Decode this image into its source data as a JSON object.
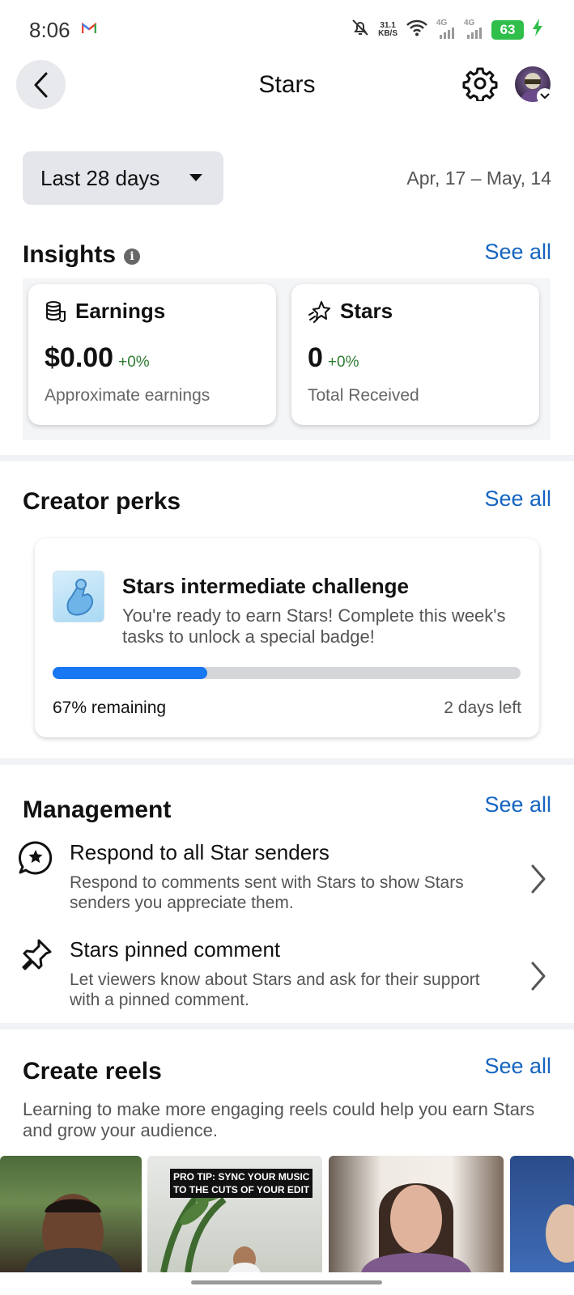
{
  "status_bar": {
    "time": "8:06",
    "net_speed_value": "31.1",
    "net_speed_unit": "KB/S",
    "signal_1": "4G",
    "signal_2": "4G",
    "battery": "63"
  },
  "header": {
    "title": "Stars"
  },
  "date_range": {
    "selected": "Last 28 days",
    "dates": "Apr, 17 – May, 14"
  },
  "insights": {
    "title": "Insights",
    "info_glyph": "i",
    "see_all": "See all",
    "cards": [
      {
        "label": "Earnings",
        "value": "$0.00",
        "change": "+0%",
        "sub": "Approximate earnings",
        "icon": "coins-icon"
      },
      {
        "label": "Stars",
        "value": "0",
        "change": "+0%",
        "sub": "Total Received",
        "icon": "star-burst-icon"
      }
    ]
  },
  "creator_perks": {
    "title": "Creator perks",
    "see_all": "See all",
    "card": {
      "title": "Stars intermediate challenge",
      "description": "You're ready to earn Stars! Complete this week's tasks to unlock a special badge!",
      "progress_fraction": 0.33,
      "remaining": "67% remaining",
      "time_left": "2 days left"
    }
  },
  "management": {
    "title": "Management",
    "see_all": "See all",
    "items": [
      {
        "title": "Respond to all Star senders",
        "description": "Respond to comments sent with Stars to show Stars senders you appreciate them.",
        "icon": "star-chat-icon"
      },
      {
        "title": "Stars pinned comment",
        "description": "Let viewers know about Stars and ask for their support with a pinned comment.",
        "icon": "pin-icon"
      }
    ]
  },
  "create_reels": {
    "title": "Create reels",
    "see_all": "See all",
    "description": "Learning to make more engaging reels could help you earn Stars and grow your audience.",
    "thumbnails": [
      {
        "caption": ""
      },
      {
        "caption_line1": "PRO TIP: SYNC YOUR MUSIC",
        "caption_line2": "TO THE CUTS OF YOUR EDIT"
      },
      {
        "caption": ""
      },
      {
        "caption": ""
      }
    ]
  },
  "colors": {
    "accent": "#1565c0",
    "progress": "#1877f2",
    "positive": "#2e7d32",
    "battery": "#2fbf4a"
  }
}
